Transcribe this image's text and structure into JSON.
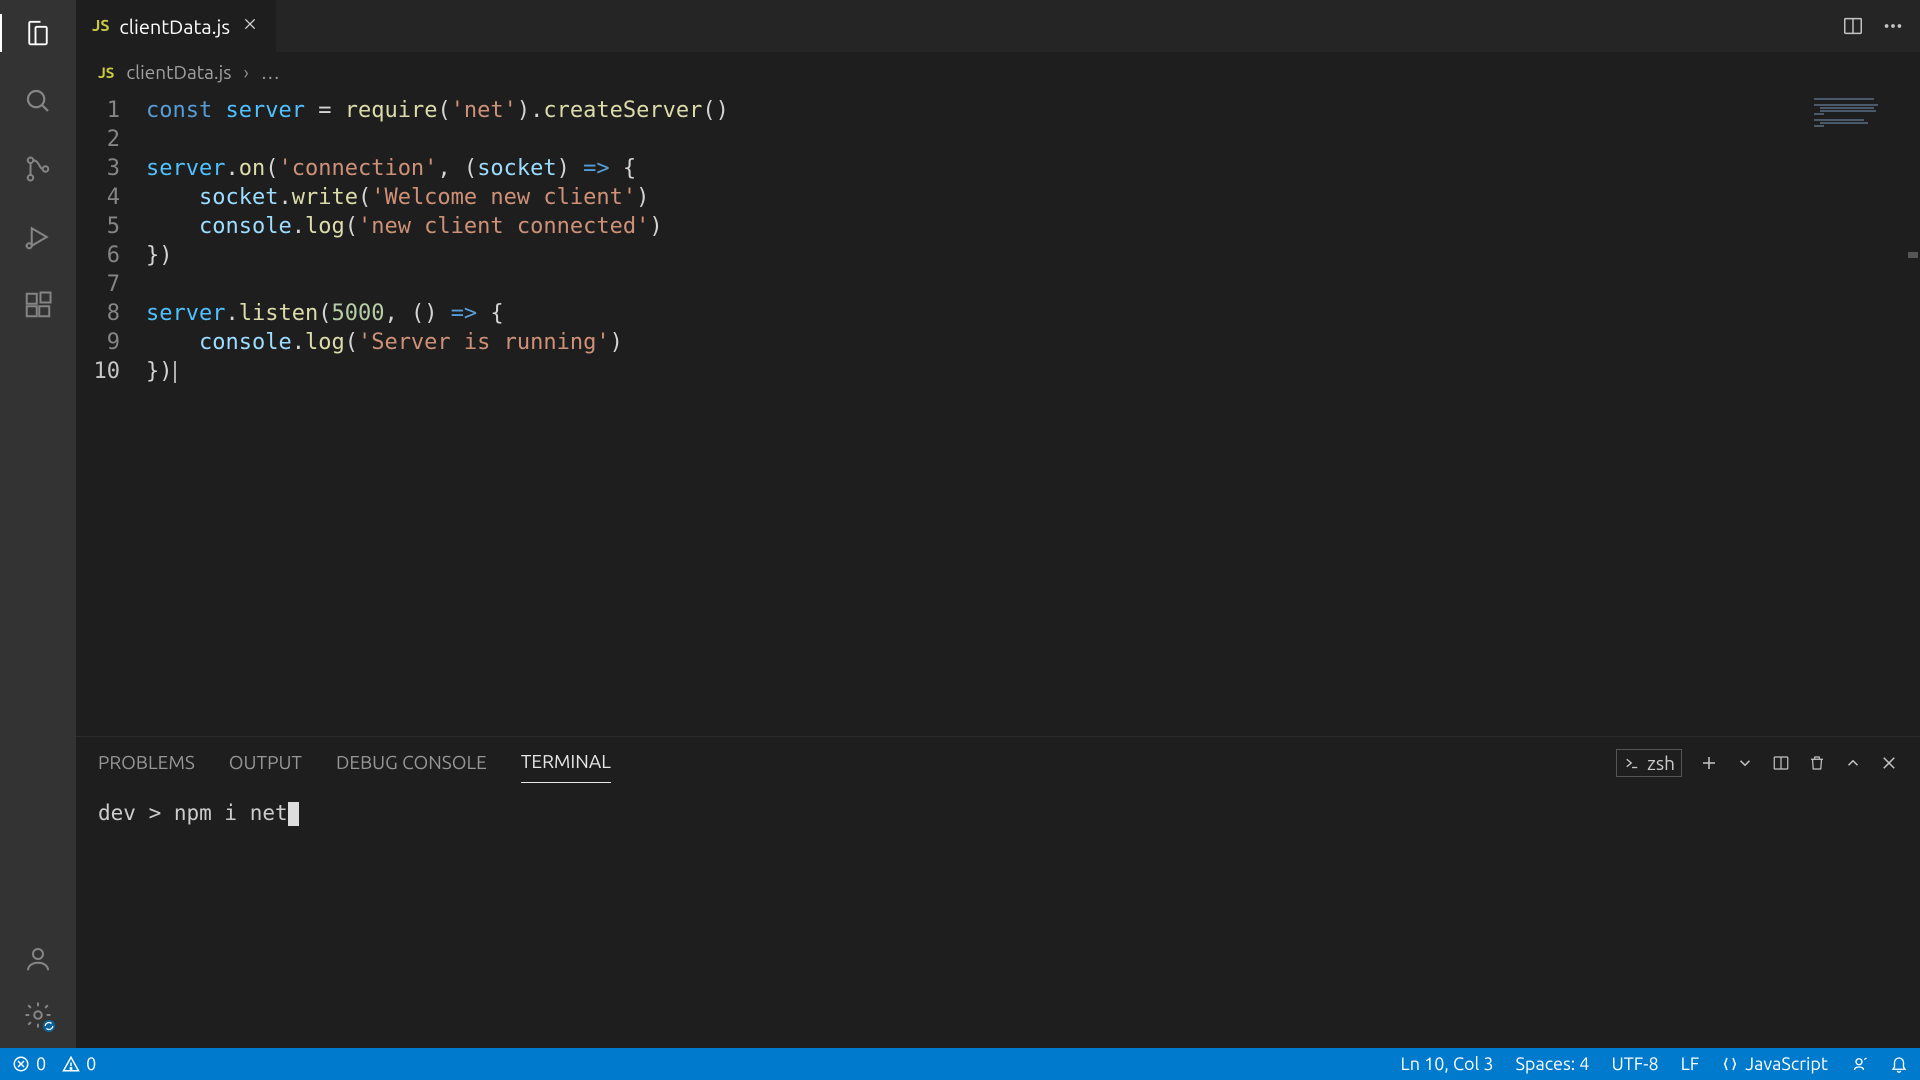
{
  "tab": {
    "badge": "JS",
    "filename": "clientData.js"
  },
  "breadcrumb": {
    "badge": "JS",
    "filename": "clientData.js",
    "trail": "…"
  },
  "editor": {
    "line_numbers": [
      "1",
      "2",
      "3",
      "4",
      "5",
      "6",
      "7",
      "8",
      "9",
      "10"
    ],
    "current_line_index": 9,
    "tokens": [
      [
        [
          "kw",
          "const"
        ],
        [
          "pun",
          " "
        ],
        [
          "const",
          "server"
        ],
        [
          "pun",
          " "
        ],
        [
          "pun",
          "="
        ],
        [
          "pun",
          " "
        ],
        [
          "fn",
          "require"
        ],
        [
          "pun",
          "("
        ],
        [
          "str",
          "'net'"
        ],
        [
          "pun",
          ")"
        ],
        [
          "pun",
          "."
        ],
        [
          "fn",
          "createServer"
        ],
        [
          "pun",
          "()"
        ]
      ],
      [],
      [
        [
          "const",
          "server"
        ],
        [
          "pun",
          "."
        ],
        [
          "fn",
          "on"
        ],
        [
          "pun",
          "("
        ],
        [
          "str",
          "'connection'"
        ],
        [
          "pun",
          ", ("
        ],
        [
          "var",
          "socket"
        ],
        [
          "pun",
          ") "
        ],
        [
          "arrow",
          "=>"
        ],
        [
          "pun",
          " {"
        ]
      ],
      [
        [
          "pun",
          "    "
        ],
        [
          "var",
          "socket"
        ],
        [
          "pun",
          "."
        ],
        [
          "fn",
          "write"
        ],
        [
          "pun",
          "("
        ],
        [
          "str",
          "'Welcome new client'"
        ],
        [
          "pun",
          ")"
        ]
      ],
      [
        [
          "pun",
          "    "
        ],
        [
          "var",
          "console"
        ],
        [
          "pun",
          "."
        ],
        [
          "fn",
          "log"
        ],
        [
          "pun",
          "("
        ],
        [
          "str",
          "'new client connected'"
        ],
        [
          "pun",
          ")"
        ]
      ],
      [
        [
          "pun",
          "})"
        ]
      ],
      [],
      [
        [
          "const",
          "server"
        ],
        [
          "pun",
          "."
        ],
        [
          "fn",
          "listen"
        ],
        [
          "pun",
          "("
        ],
        [
          "num",
          "5000"
        ],
        [
          "pun",
          ", () "
        ],
        [
          "arrow",
          "=>"
        ],
        [
          "pun",
          " {"
        ]
      ],
      [
        [
          "pun",
          "    "
        ],
        [
          "var",
          "console"
        ],
        [
          "pun",
          "."
        ],
        [
          "fn",
          "log"
        ],
        [
          "pun",
          "("
        ],
        [
          "str",
          "'Server is running'"
        ],
        [
          "pun",
          ")"
        ]
      ],
      [
        [
          "pun",
          "})"
        ]
      ]
    ]
  },
  "panel": {
    "tabs": {
      "problems": "PROBLEMS",
      "output": "OUTPUT",
      "debug_console": "DEBUG CONSOLE",
      "terminal": "TERMINAL"
    },
    "shell": "zsh",
    "terminal_line": "dev > npm i net"
  },
  "status": {
    "errors": "0",
    "warnings": "0",
    "cursor": "Ln 10, Col 3",
    "spaces": "Spaces: 4",
    "encoding": "UTF-8",
    "eol": "LF",
    "language": "JavaScript"
  },
  "colors": {
    "status_bar": "#007acc",
    "accent": "#0e639c"
  }
}
